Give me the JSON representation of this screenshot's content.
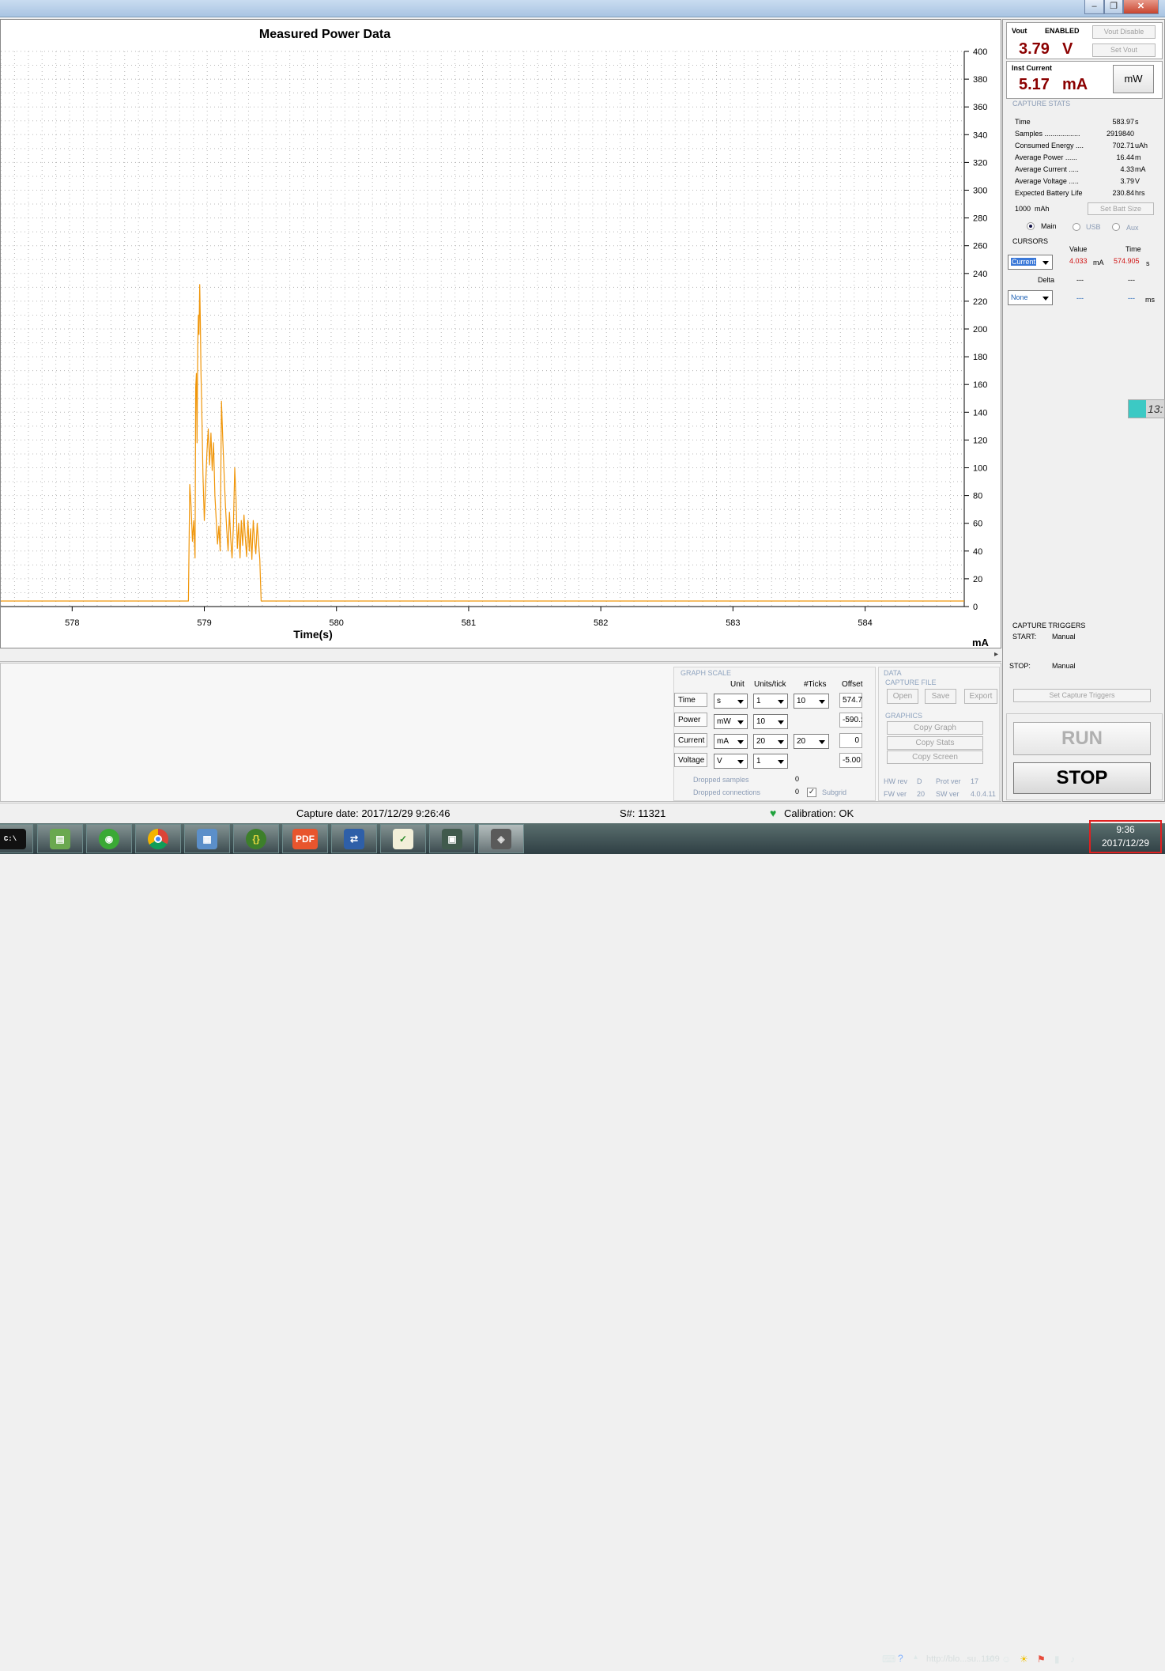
{
  "window": {
    "controls": [
      "‒",
      "❐",
      "✕"
    ]
  },
  "chart_data": {
    "type": "line",
    "title": "Measured Power Data",
    "xlabel": "Time(s)",
    "ylabel": "mA",
    "xlim": [
      577.46,
      584.75
    ],
    "ylim": [
      0,
      400
    ],
    "x_ticks": [
      578,
      579,
      580,
      581,
      582,
      583,
      584
    ],
    "y_ticks": [
      0,
      20,
      40,
      60,
      80,
      100,
      120,
      140,
      160,
      180,
      200,
      220,
      240,
      260,
      280,
      300,
      320,
      340,
      360,
      380,
      400
    ],
    "grid": true,
    "color": "#f0960a",
    "series": [
      {
        "x": [
          577.46,
          578.88,
          578.89,
          578.9,
          578.91,
          578.92,
          578.93,
          578.935,
          578.94,
          578.945,
          578.95,
          578.955,
          578.96,
          578.965,
          578.97,
          578.975,
          578.98,
          578.99,
          579.0,
          579.01,
          579.02,
          579.03,
          579.04,
          579.05,
          579.06,
          579.07,
          579.08,
          579.09,
          579.1,
          579.11,
          579.12,
          579.13,
          579.14,
          579.15,
          579.16,
          579.17,
          579.18,
          579.19,
          579.2,
          579.21,
          579.22,
          579.23,
          579.24,
          579.25,
          579.26,
          579.27,
          579.28,
          579.29,
          579.3,
          579.31,
          579.32,
          579.33,
          579.34,
          579.35,
          579.36,
          579.37,
          579.38,
          579.39,
          579.4,
          579.42,
          579.43,
          579.45,
          584.75
        ],
        "values": [
          4,
          4,
          88,
          72,
          47,
          62,
          35,
          158,
          168,
          118,
          188,
          210,
          196,
          232,
          205,
          168,
          145,
          95,
          62,
          88,
          112,
          128,
          102,
          125,
          98,
          118,
          80,
          62,
          45,
          58,
          40,
          148,
          120,
          95,
          72,
          55,
          40,
          68,
          48,
          35,
          58,
          100,
          78,
          42,
          60,
          35,
          62,
          44,
          66,
          50,
          36,
          62,
          40,
          56,
          34,
          62,
          48,
          38,
          60,
          34,
          4,
          4,
          4
        ]
      }
    ]
  },
  "bottom": {
    "graph_scale_title": "GRAPH SCALE",
    "headers": {
      "unit": "Unit",
      "units_per_tick": "Units/tick",
      "ticks": "#Ticks",
      "offset": "Offset"
    },
    "rows": [
      {
        "label": "Time",
        "unit": "s",
        "upt": "1",
        "ticks": "10",
        "offset": "574.7"
      },
      {
        "label": "Power",
        "unit": "mW",
        "upt": "10",
        "ticks": "",
        "offset": "-590.:"
      },
      {
        "label": "Current",
        "unit": "mA",
        "upt": "20",
        "ticks": "20",
        "offset": "0"
      },
      {
        "label": "Voltage",
        "unit": "V",
        "upt": "1",
        "ticks": "",
        "offset": "-5.00"
      }
    ],
    "dropped_samples_label": "Dropped samples",
    "dropped_samples": "0",
    "dropped_connections_label": "Dropped connections",
    "dropped_connections": "0",
    "subgrid_label": "Subgrid",
    "subgrid_checked": true,
    "data_title": "DATA",
    "capture_file_title": "CAPTURE FILE",
    "open": "Open",
    "save": "Save",
    "export": "Export",
    "graphics_title": "GRAPHICS",
    "copy_graph": "Copy Graph",
    "copy_stats": "Copy Stats",
    "copy_screen": "Copy Screen",
    "hw_rev_label": "HW rev",
    "hw_rev": "D",
    "prot_ver_label": "Prot ver",
    "prot_ver": "17",
    "fw_ver_label": "FW ver",
    "fw_ver": "20",
    "sw_ver_label": "SW ver",
    "sw_ver": "4.0.4.11"
  },
  "right": {
    "vout_label": "Vout",
    "vout_state": "ENABLED",
    "vout_disable": "Vout Disable",
    "vout_value": "3.79",
    "vout_unit": "V",
    "set_vout": "Set Vout",
    "inst_label": "Inst Current",
    "inst_value": "5.17",
    "inst_unit": "mA",
    "mw_button": "mW",
    "stats_title": "CAPTURE STATS",
    "stats": [
      {
        "name": "Time",
        "value": "583.97",
        "unit": "s"
      },
      {
        "name": "Samples ..................",
        "value": "2919840",
        "unit": ""
      },
      {
        "name": "Consumed Energy ....",
        "value": "702.71",
        "unit": "uAh"
      },
      {
        "name": "Average Power ......",
        "value": "16.44",
        "unit": "m"
      },
      {
        "name": "Average Current .....",
        "value": "4.33",
        "unit": "mA"
      },
      {
        "name": "Average Voltage .....",
        "value": "3.79",
        "unit": "V"
      },
      {
        "name": "Expected Battery Life",
        "value": "230.84",
        "unit": "hrs"
      }
    ],
    "batt_size": "1000",
    "batt_unit": "mAh",
    "set_batt": "Set Batt Size",
    "channels": [
      "Main",
      "USB",
      "Aux"
    ],
    "cursors_title": "CURSORS",
    "value_header": "Value",
    "time_header": "Time",
    "cursor_select": "Current",
    "cursor_value": "4.033",
    "cursor_value_unit": "mA",
    "cursor_time": "574.905",
    "cursor_time_unit": "s",
    "delta_label": "Delta",
    "delta_value": "---",
    "delta_time": "---",
    "second_select": "None",
    "second_value": "---",
    "second_time": "---",
    "second_time_unit": "ms",
    "triggers_title": "CAPTURE TRIGGERS",
    "start_label": "START:",
    "start_value": "Manual",
    "stop_label": "STOP:",
    "stop_value": "Manual",
    "set_triggers": "Set Capture Triggers",
    "run": "RUN",
    "stop": "STOP"
  },
  "side_tab_text": "13:",
  "status": {
    "capture_date": "Capture date: 2017/12/29 9:26:46",
    "serial": "S#: 11321",
    "calibration": "Calibration: OK"
  },
  "taskbar": {
    "apps": [
      "cmd-icon",
      "android-icon",
      "wifi-icon",
      "chrome-icon",
      "network-icon",
      "braces-icon",
      "pdf-icon",
      "remote-icon",
      "chart-icon",
      "monitor-icon",
      "device-icon"
    ],
    "cmd_text": "C:\\",
    "pdf_text": "PDF",
    "braces_text": "{}",
    "tray_watermark": "http://blo...su..1109",
    "clock_time": "9:36",
    "clock_date": "2017/12/29"
  }
}
